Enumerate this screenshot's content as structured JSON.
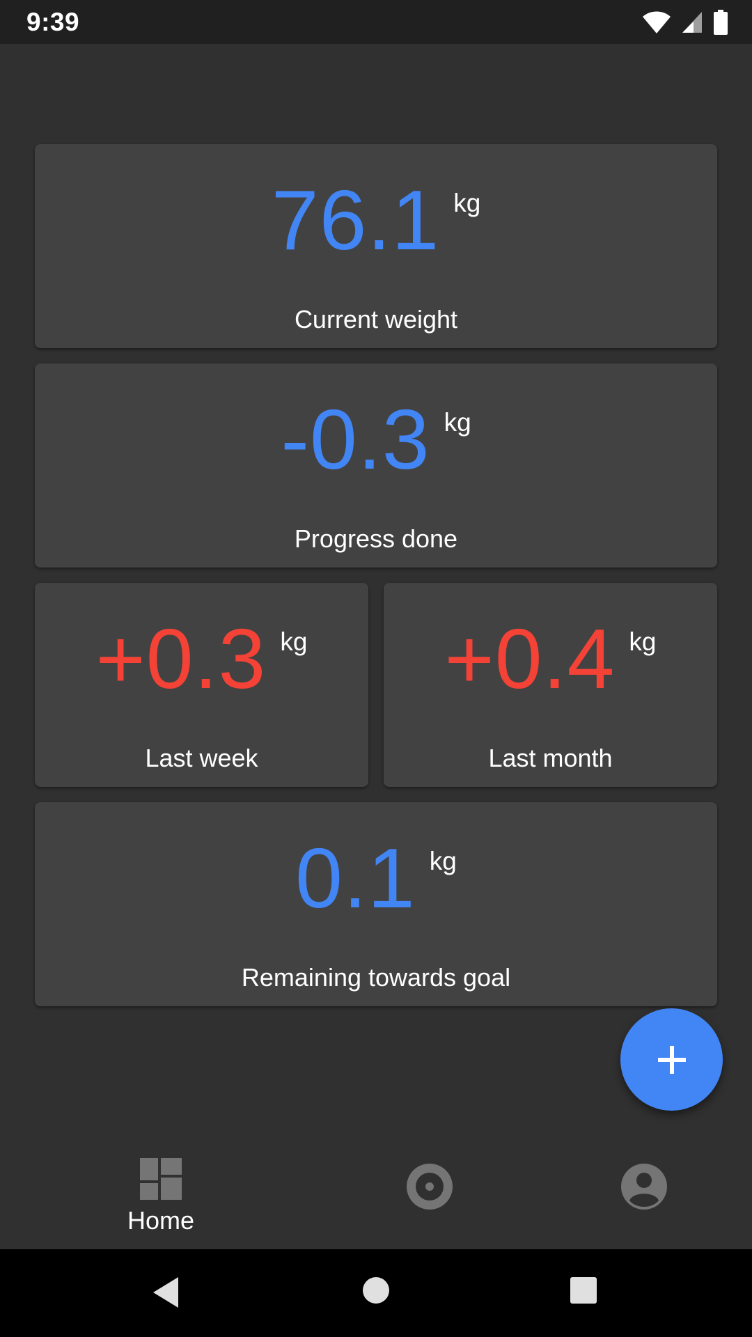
{
  "status_bar": {
    "time": "9:39",
    "icons": [
      "wifi-icon",
      "cellular-signal-icon",
      "battery-icon"
    ]
  },
  "cards": {
    "current_weight": {
      "value": "76.1",
      "unit": "kg",
      "label": "Current weight",
      "color": "#4285f4"
    },
    "progress_done": {
      "value": "-0.3",
      "unit": "kg",
      "label": "Progress done",
      "color": "#4285f4"
    },
    "last_week": {
      "value": "+0.3",
      "unit": "kg",
      "label": "Last week",
      "color": "#f44336"
    },
    "last_month": {
      "value": "+0.4",
      "unit": "kg",
      "label": "Last month",
      "color": "#f44336"
    },
    "remaining_goal": {
      "value": "0.1",
      "unit": "kg",
      "label": "Remaining towards goal",
      "color": "#4285f4"
    }
  },
  "fab": {
    "icon": "plus-icon",
    "color": "#4285f4"
  },
  "bottom_nav": {
    "items": [
      {
        "icon": "dashboard-icon",
        "label": "Home",
        "selected": true
      },
      {
        "icon": "target-icon",
        "label": "",
        "selected": false
      },
      {
        "icon": "account-circle-icon",
        "label": "",
        "selected": false
      }
    ]
  },
  "system_nav": {
    "icons": [
      "back-icon",
      "home-icon",
      "recents-icon"
    ]
  },
  "colors": {
    "background": "#303030",
    "card": "#424242",
    "accent_blue": "#4285f4",
    "accent_red": "#f44336",
    "inactive_icon": "#757575"
  }
}
